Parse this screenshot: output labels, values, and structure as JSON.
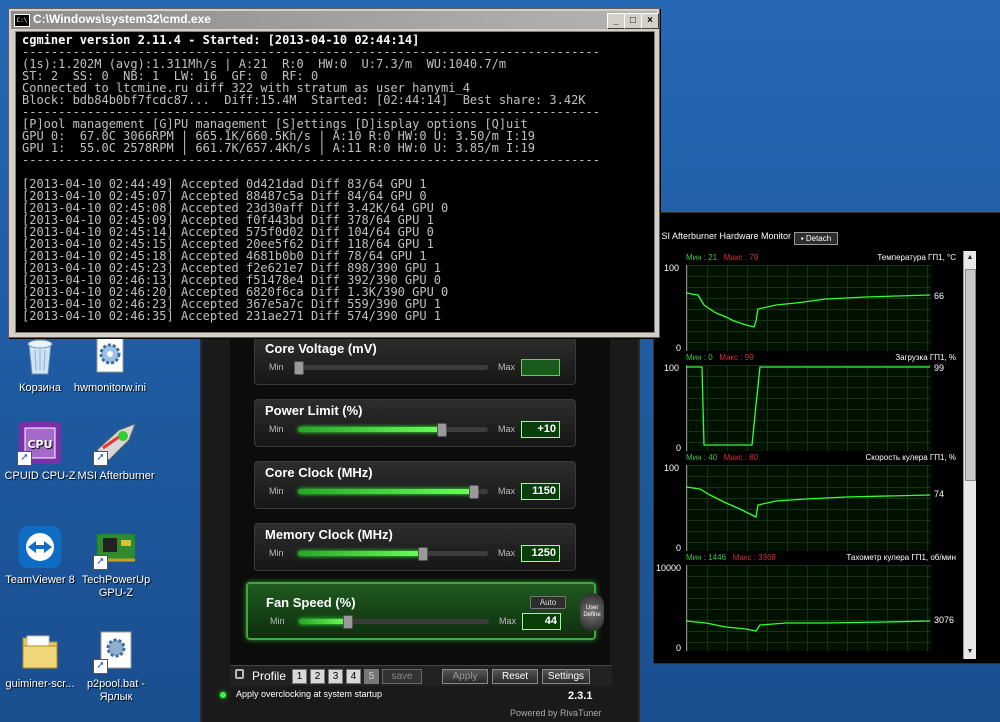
{
  "cmd_window": {
    "title": "C:\\Windows\\system32\\cmd.exe",
    "minimize": "_",
    "maximize": "□",
    "close": "×",
    "header_line": "cgminer version 2.11.4 - Started: [2013-04-10 02:44:14]",
    "status_lines": [
      "(1s):1.202M (avg):1.311Mh/s | A:21  R:0  HW:0  U:7.3/m  WU:1040.7/m",
      "ST: 2  SS: 0  NB: 1  LW: 16  GF: 0  RF: 0",
      "Connected to ltcmine.ru diff 322 with stratum as user hanymi_4",
      "Block: bdb84b0bf7fcdc87...  Diff:15.4M  Started: [02:44:14]  Best share: 3.42K"
    ],
    "menu_line": "[P]ool management [G]PU management [S]ettings [D]isplay options [Q]uit",
    "gpu_lines": [
      "GPU 0:  67.0C 3066RPM | 665.1K/660.5Kh/s | A:10 R:0 HW:0 U: 3.50/m I:19",
      "GPU 1:  55.0C 2578RPM | 661.7K/657.4Kh/s | A:11 R:0 HW:0 U: 3.85/m I:19"
    ],
    "log_lines": [
      "[2013-04-10 02:44:49] Accepted 0d421dad Diff 83/64 GPU 1",
      "[2013-04-10 02:45:07] Accepted 88487c5a Diff 84/64 GPU 0",
      "[2013-04-10 02:45:08] Accepted 23d30aff Diff 3.42K/64 GPU 0",
      "[2013-04-10 02:45:09] Accepted f0f443bd Diff 378/64 GPU 1",
      "[2013-04-10 02:45:14] Accepted 575f0d02 Diff 104/64 GPU 0",
      "[2013-04-10 02:45:15] Accepted 20ee5f62 Diff 118/64 GPU 1",
      "[2013-04-10 02:45:18] Accepted 4681b0b0 Diff 78/64 GPU 1",
      "[2013-04-10 02:45:23] Accepted f2e621e7 Diff 898/390 GPU 1",
      "[2013-04-10 02:46:13] Accepted f51478e4 Diff 392/390 GPU 0",
      "[2013-04-10 02:46:20] Accepted 6820f6ca Diff 1.3K/390 GPU 0",
      "[2013-04-10 02:46:23] Accepted 367e5a7c Diff 559/390 GPU 1",
      "[2013-04-10 02:46:35] Accepted 231ae271 Diff 574/390 GPU 1"
    ]
  },
  "desktop_icons": [
    {
      "label": "Корзина",
      "icon": "recycle-bin-icon"
    },
    {
      "label": "hwmonitorw.ini",
      "icon": "settings-file-icon"
    },
    {
      "label": "CPUID CPU-Z",
      "icon": "cpuz-icon"
    },
    {
      "label": "MSI Afterburner",
      "icon": "afterburner-icon"
    },
    {
      "label": "TeamViewer 8",
      "icon": "teamviewer-icon"
    },
    {
      "label": "TechPowerUp GPU-Z",
      "icon": "gpuz-icon"
    },
    {
      "label": "guiminer-scr...",
      "icon": "folder-icon"
    },
    {
      "label": "p2pool.bat - Ярлык",
      "icon": "batch-file-icon"
    }
  ],
  "afterburner": {
    "sliders": [
      {
        "label": "Core Voltage (mV)",
        "min": "Min",
        "max": "Max",
        "value": "",
        "fraction": 0.0
      },
      {
        "label": "Power Limit (%)",
        "min": "Min",
        "max": "Max",
        "value": "+10",
        "fraction": 0.75
      },
      {
        "label": "Core Clock (MHz)",
        "min": "Min",
        "max": "Max",
        "value": "1150",
        "fraction": 0.92
      },
      {
        "label": "Memory Clock (MHz)",
        "min": "Min",
        "max": "Max",
        "value": "1250",
        "fraction": 0.65
      },
      {
        "label": "Fan Speed (%)",
        "min": "Min",
        "max": "Max",
        "value": "44",
        "fraction": 0.25
      }
    ],
    "auto_label": "Auto",
    "user_define_label": "User Define",
    "profile_label": "Profile",
    "profile_slots": [
      "1",
      "2",
      "3",
      "4",
      "5"
    ],
    "save_label": "save",
    "apply_label": "Apply",
    "reset_label": "Reset",
    "settings_label": "Settings",
    "startup_text": "Apply overclocking at system startup",
    "version": "2.3.1",
    "powered_by": "Powered by RivaTuner"
  },
  "hardware_monitor": {
    "title": "MSI Afterburner Hardware Monitor",
    "detach_label": "Detach",
    "graphs": [
      {
        "min_label": "Мин : 21",
        "max_label": "Макс : 79",
        "name": "Температура ГП1, °C",
        "top": "100",
        "bottom": "0",
        "current": "66"
      },
      {
        "min_label": "Мин : 0",
        "max_label": "Макс : 99",
        "name": "Загрузка ГП1, %",
        "top": "100",
        "bottom": "0",
        "current": "99"
      },
      {
        "min_label": "Мин : 40",
        "max_label": "Макс : 80",
        "name": "Скорость кулера ГП1, %",
        "top": "100",
        "bottom": "0",
        "current": "74"
      },
      {
        "min_label": "Мин : 1446",
        "max_label": "Макс : 3368",
        "name": "Тахометр кулера ГП1, об/мин",
        "top": "10000",
        "bottom": "0",
        "current": "3076"
      }
    ]
  }
}
